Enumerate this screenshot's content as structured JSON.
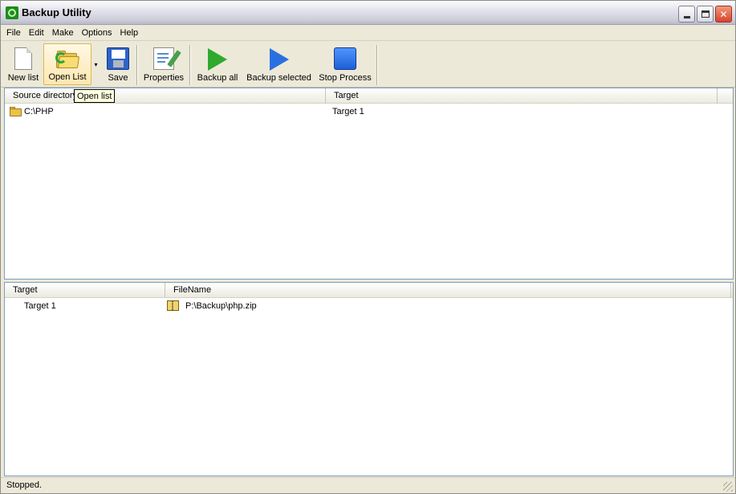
{
  "window": {
    "title": "Backup Utility"
  },
  "menu": [
    "File",
    "Edit",
    "Make",
    "Options",
    "Help"
  ],
  "toolbar": {
    "new_list": "New list",
    "open_list": "Open List",
    "save": "Save",
    "properties": "Properties",
    "backup_all": "Backup all",
    "backup_selected": "Backup selected",
    "stop_process": "Stop Process",
    "dropdown_arrow": "▾"
  },
  "tooltip": "Open list",
  "top_list": {
    "columns": [
      "Source directory",
      "Target"
    ],
    "rows": [
      {
        "source": "C:\\PHP",
        "target": "Target 1"
      }
    ]
  },
  "bottom_list": {
    "columns": [
      "Target",
      "FileName"
    ],
    "rows": [
      {
        "target": "Target 1",
        "filename": "P:\\Backup\\php.zip"
      }
    ]
  },
  "status": "Stopped."
}
